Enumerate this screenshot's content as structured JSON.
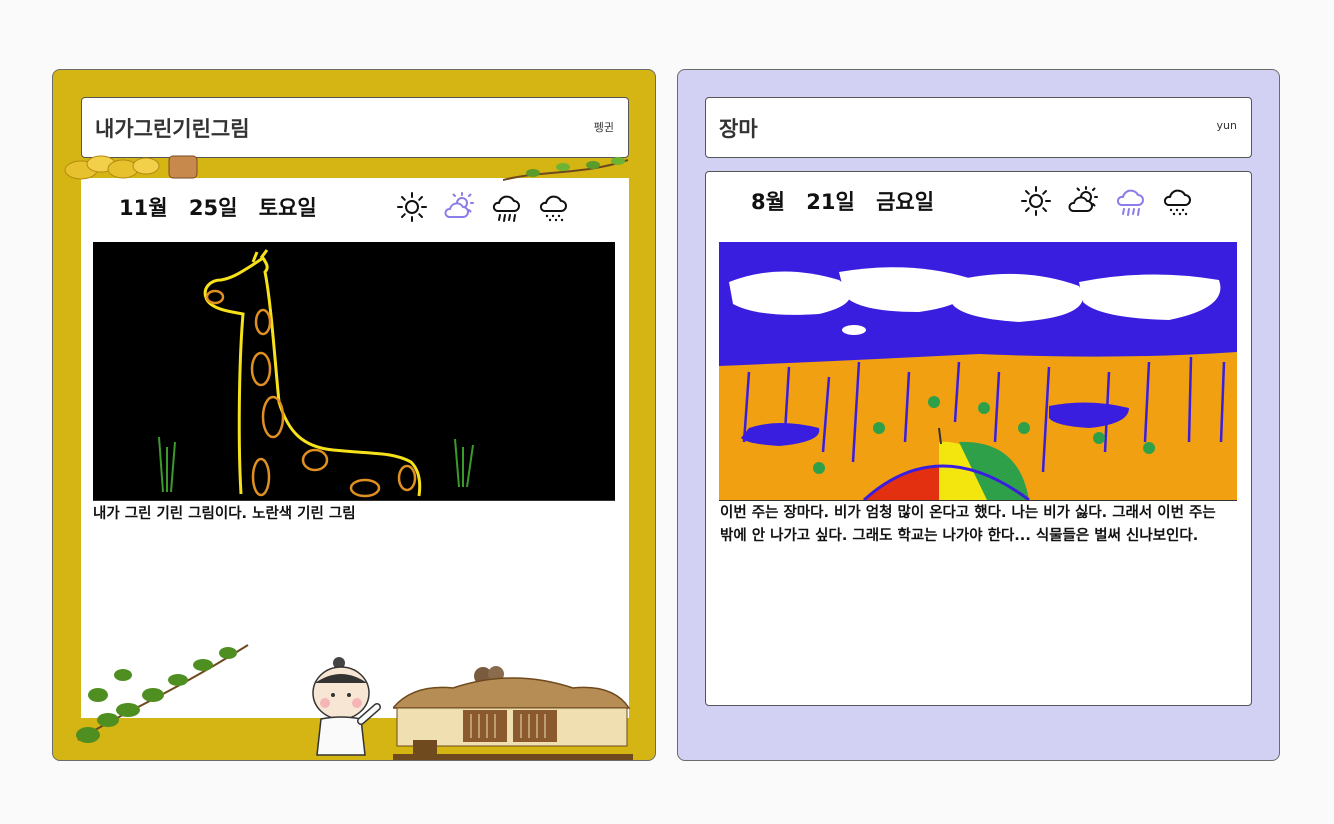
{
  "cards": [
    {
      "title": "내가그린기린그림",
      "author": "펭귄",
      "date": {
        "month": "11월",
        "day": "25일",
        "weekday": "토요일"
      },
      "weather_icons": [
        "sun-icon",
        "partly-cloudy-icon",
        "rain-icon",
        "snow-icon"
      ],
      "selected_weather": "partly-cloudy-icon",
      "drawing_subject": "giraffe",
      "body": "내가 그린 기린 그림이다. 노란색 기린 그림",
      "colors": {
        "card_bg": "#d4b513",
        "selected": "#8a7de8"
      }
    },
    {
      "title": "장마",
      "author": "yun",
      "date": {
        "month": "8월",
        "day": "21일",
        "weekday": "금요일"
      },
      "weather_icons": [
        "sun-icon",
        "partly-cloudy-icon",
        "rain-icon",
        "snow-icon"
      ],
      "selected_weather": "rain-icon",
      "drawing_subject": "rainy-season",
      "body": "이번 주는 장마다. 비가 엄청 많이 온다고 했다. 나는 비가 싫다. 그래서 이번 주는 밖에 안 나가고 싶다. 그래도 학교는 나가야 한다... 식물들은 벌써 신나보인다.",
      "colors": {
        "card_bg": "#d3d1f3",
        "selected": "#8a7de8"
      }
    }
  ]
}
